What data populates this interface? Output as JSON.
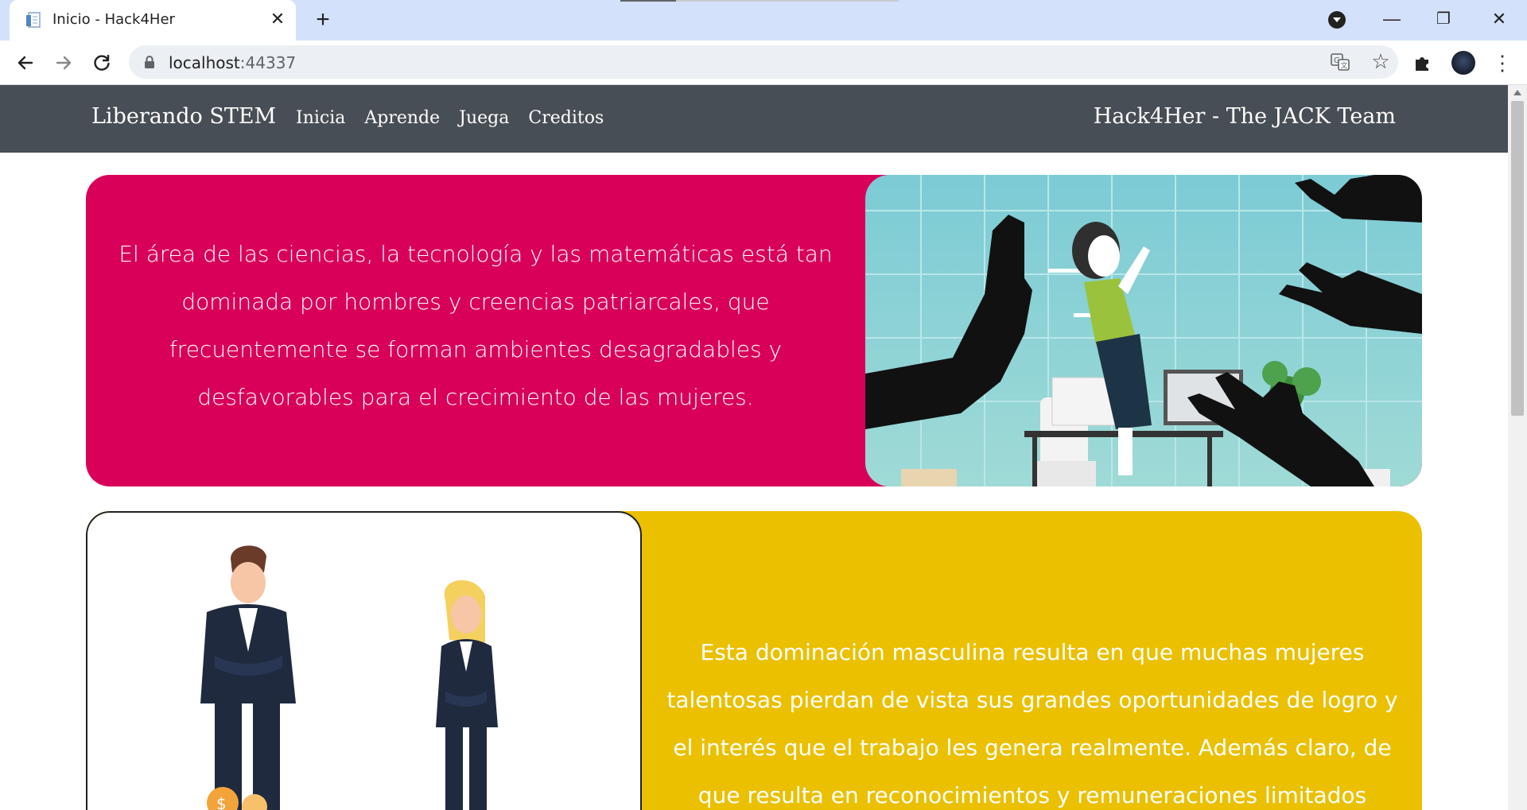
{
  "browser": {
    "tab_title": "Inicio - Hack4Her",
    "new_tab_label": "+",
    "url_host": "localhost",
    "url_port": ":44337",
    "window_controls": {
      "minimize": "—",
      "restore": "❐",
      "close": "✕"
    },
    "tab_close": "✕",
    "star": "☆",
    "menu": "⋮"
  },
  "site_nav": {
    "brand": "Liberando STEM",
    "links": [
      "Inicia",
      "Aprende",
      "Juega",
      "Creditos"
    ],
    "team": "Hack4Her - The JACK Team"
  },
  "sections": [
    {
      "text": "El área de las ciencias, la tecnología y las matemáticas está tan dominada por hombres y creencias patriarcales, que frecuentemente se forman ambientes desagradables y desfavorables para el crecimiento de las mujeres.",
      "color": "#d9005a",
      "illustration": "woman-surrounded-by-hands-illustration"
    },
    {
      "text": "Esta dominación masculina resulta en que muchas mujeres talentosas pierdan de vista sus grandes oportunidades de logro y el interés que el trabajo les genera realmente. Además claro, de que resulta en reconocimientos y remuneraciones limitados",
      "color": "#ebc000",
      "illustration": "man-and-woman-businesspeople-illustration"
    }
  ]
}
